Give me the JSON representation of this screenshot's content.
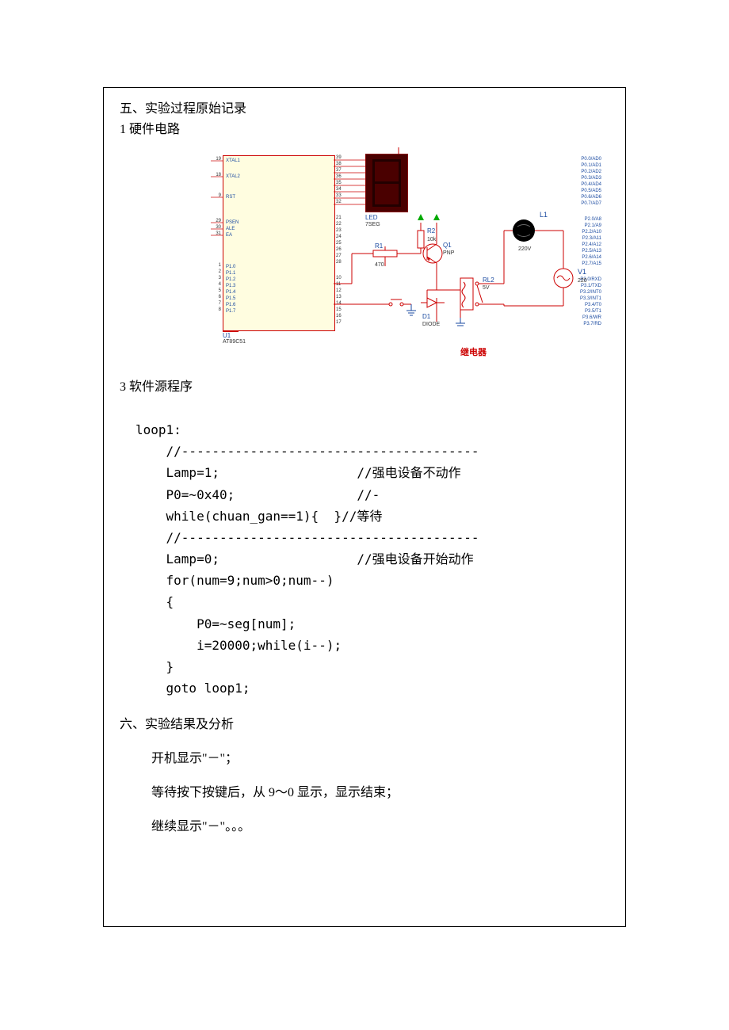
{
  "section5": {
    "title": "五、实验过程原始记录",
    "sub1_title": "1   硬件电路",
    "sub3_title": "3   软件源程序"
  },
  "circuit": {
    "chip_ref": "U1",
    "chip_part": "AT89C51",
    "left_pins_top": {
      "19": "XTAL1",
      "18": "XTAL2",
      "9": "RST"
    },
    "left_pins_group2": {
      "29": "PSEN",
      "30": "ALE",
      "31": "EA"
    },
    "left_pins_p1": [
      {
        "n": "1",
        "name": "P1.0"
      },
      {
        "n": "2",
        "name": "P1.1"
      },
      {
        "n": "3",
        "name": "P1.2"
      },
      {
        "n": "4",
        "name": "P1.3"
      },
      {
        "n": "5",
        "name": "P1.4"
      },
      {
        "n": "6",
        "name": "P1.5"
      },
      {
        "n": "7",
        "name": "P1.6"
      },
      {
        "n": "8",
        "name": "P1.7"
      }
    ],
    "right_pins_p0": [
      {
        "n": "39",
        "name": "P0.0/AD0"
      },
      {
        "n": "38",
        "name": "P0.1/AD1"
      },
      {
        "n": "37",
        "name": "P0.2/AD2"
      },
      {
        "n": "36",
        "name": "P0.3/AD3"
      },
      {
        "n": "35",
        "name": "P0.4/AD4"
      },
      {
        "n": "34",
        "name": "P0.5/AD5"
      },
      {
        "n": "33",
        "name": "P0.6/AD6"
      },
      {
        "n": "32",
        "name": "P0.7/AD7"
      }
    ],
    "right_pins_p2": [
      {
        "n": "21",
        "name": "P2.0/A8"
      },
      {
        "n": "22",
        "name": "P2.1/A9"
      },
      {
        "n": "23",
        "name": "P2.2/A10"
      },
      {
        "n": "24",
        "name": "P2.3/A11"
      },
      {
        "n": "25",
        "name": "P2.4/A12"
      },
      {
        "n": "26",
        "name": "P2.5/A13"
      },
      {
        "n": "27",
        "name": "P2.6/A14"
      },
      {
        "n": "28",
        "name": "P2.7/A15"
      }
    ],
    "right_pins_p3": [
      {
        "n": "10",
        "name": "P3.0/RXD"
      },
      {
        "n": "11",
        "name": "P3.1/TXD"
      },
      {
        "n": "12",
        "name": "P3.2/INT0"
      },
      {
        "n": "13",
        "name": "P3.3/INT1"
      },
      {
        "n": "14",
        "name": "P3.4/T0"
      },
      {
        "n": "15",
        "name": "P3.5/T1"
      },
      {
        "n": "16",
        "name": "P3.6/WR"
      },
      {
        "n": "17",
        "name": "P3.7/RD"
      }
    ],
    "led_ref": "LED",
    "led_sub": "7SEG",
    "r1_ref": "R1",
    "r1_val": "470",
    "r2_ref": "R2",
    "r2_val": "10k",
    "q1_ref": "Q1",
    "q1_type": "PNP",
    "d1_ref": "D1",
    "d1_type": "DIODE",
    "rl2_ref": "RL2",
    "rl2_val": "5V",
    "l1_ref": "L1",
    "l1_val": "220V",
    "v1_ref": "V1",
    "v1_val": "220",
    "relay_text": "继电器"
  },
  "code": {
    "l0": "loop1:",
    "l1": "//---------------------------------------",
    "l2": "Lamp=1;",
    "l2c": "//强电设备不动作",
    "l3": "P0=~0x40;",
    "l3c": "//-",
    "l4": "while(chuan_gan==1){  }//等待",
    "l5": "//---------------------------------------",
    "l6": "Lamp=0;",
    "l6c": "//强电设备开始动作",
    "l7": "for(num=9;num>0;num--)",
    "l8": "{",
    "l9": "P0=~seg[num];",
    "l10": "i=20000;while(i--);",
    "l11": "}",
    "l12": "goto loop1;"
  },
  "section6": {
    "title": "六、实验结果及分析",
    "line1": "开机显示\"－\"；",
    "line2": "等待按下按键后，从 9～0 显示，显示结束；",
    "line3": "继续显示\"－\"。。。"
  }
}
